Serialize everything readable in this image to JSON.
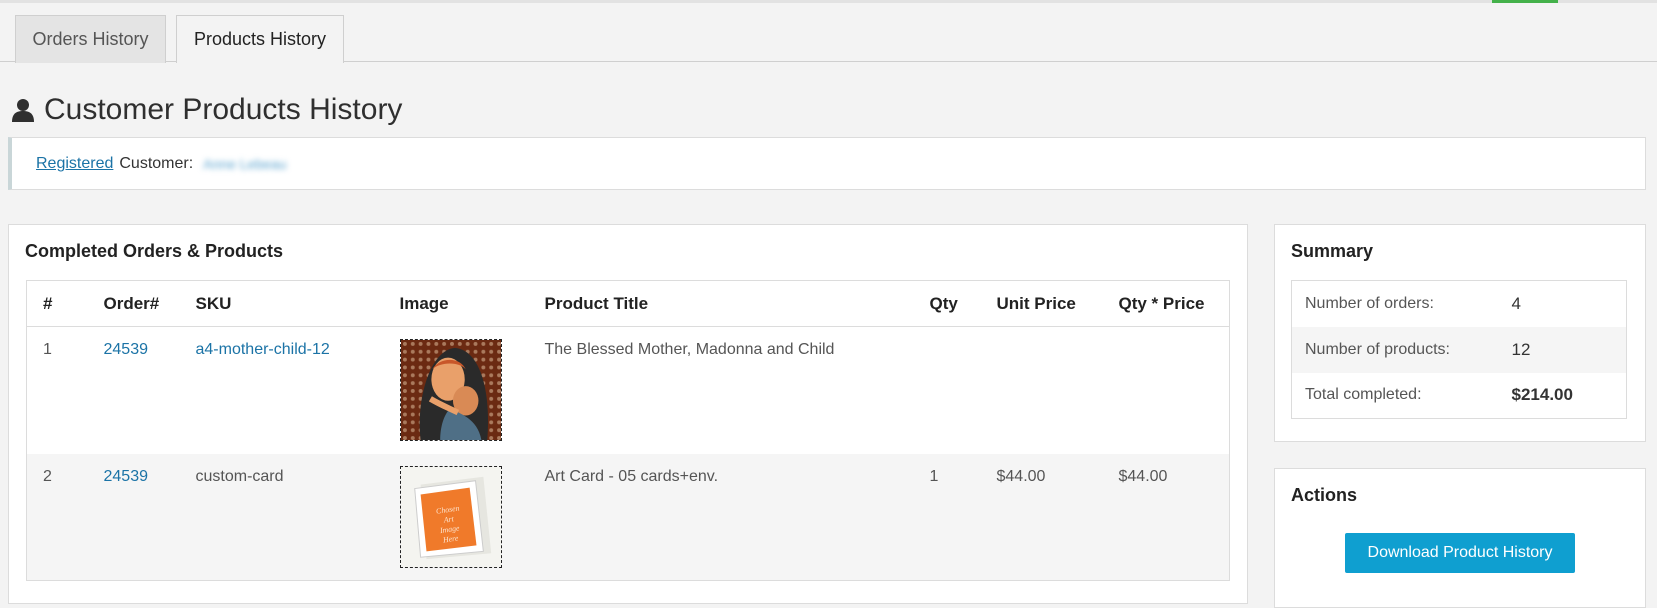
{
  "tabs": [
    {
      "label": "Orders History",
      "active": false
    },
    {
      "label": "Products History",
      "active": true
    }
  ],
  "page": {
    "title": "Customer Products History",
    "icon": "user-icon"
  },
  "notice": {
    "link_label": "Registered",
    "text": "Customer:",
    "customer_name": "Anne Lebeau"
  },
  "orders_panel": {
    "title": "Completed Orders & Products",
    "columns": [
      "#",
      "Order#",
      "SKU",
      "Image",
      "Product Title",
      "Qty",
      "Unit Price",
      "Qty * Price"
    ],
    "rows": [
      {
        "num": "1",
        "order": "24539",
        "sku": "a4-mother-child-12",
        "sku_link": true,
        "image": "madonna-art-thumbnail",
        "title": "The Blessed Mother, Madonna and Child",
        "qty": "",
        "unit_price": "",
        "total": ""
      },
      {
        "num": "2",
        "order": "24539",
        "sku": "custom-card",
        "sku_link": false,
        "image": "art-card-thumbnail",
        "title": "Art Card - 05 cards+env.",
        "qty": "1",
        "unit_price": "$44.00",
        "total": "$44.00"
      }
    ]
  },
  "summary_panel": {
    "title": "Summary",
    "rows": [
      {
        "label": "Number of orders:",
        "value": "4"
      },
      {
        "label": "Number of products:",
        "value": "12"
      },
      {
        "label": "Total completed:",
        "value": "$214.00"
      }
    ]
  },
  "actions_panel": {
    "title": "Actions",
    "download_label": "Download Product History"
  },
  "colors": {
    "link": "#1b73a6",
    "button": "#0f9fd0",
    "accent_green": "#44b14a",
    "card_orange": "#f07a2a"
  }
}
